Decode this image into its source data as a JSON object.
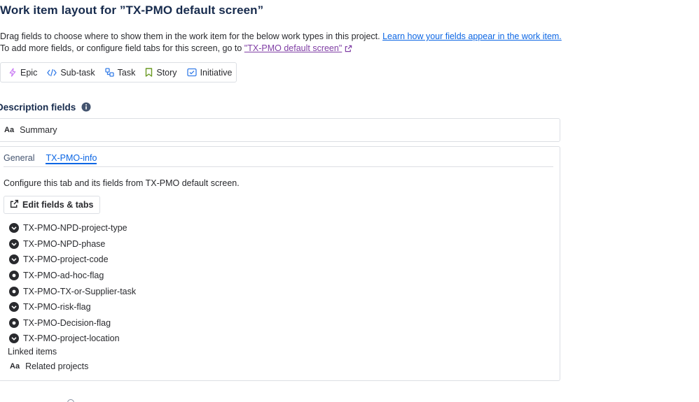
{
  "title": "Work item layout for ”TX-PMO default screen”",
  "intro": {
    "line1_text": "Drag fields to choose where to show them in the work item for the below work types in this project. ",
    "line1_link": "Learn how your fields appear in the work item.",
    "line2_text": "To add more fields, or configure field tabs for this screen, go to ",
    "line2_link": "\"TX-PMO default screen\""
  },
  "work_types": [
    {
      "label": "Epic",
      "icon": "lightning-icon",
      "color": "#c97cf4"
    },
    {
      "label": "Sub-task",
      "icon": "code-icon",
      "color": "#357de8"
    },
    {
      "label": "Task",
      "icon": "subtask-icon",
      "color": "#357de8"
    },
    {
      "label": "Story",
      "icon": "bookmark-icon",
      "color": "#6a9a23"
    },
    {
      "label": "Initiative",
      "icon": "checkbox-icon",
      "color": "#357de8"
    }
  ],
  "description_section": {
    "title": "Description fields",
    "summary_label": "Summary",
    "summary_icon_text": "Aa"
  },
  "tabs": [
    {
      "label": "General",
      "active": false
    },
    {
      "label": "TX-PMO-info",
      "active": true
    }
  ],
  "tab_content": {
    "config_text": "Configure this tab and its fields from TX-PMO default screen.",
    "edit_button": "Edit fields & tabs"
  },
  "fields": [
    {
      "label": "TX-PMO-NPD-project-type",
      "icon": "dropdown-icon"
    },
    {
      "label": "TX-PMO-NPD-phase",
      "icon": "dropdown-icon"
    },
    {
      "label": "TX-PMO-project-code",
      "icon": "dropdown-icon"
    },
    {
      "label": "TX-PMO-ad-hoc-flag",
      "icon": "radio-icon"
    },
    {
      "label": "TX-PMO-TX-or-Supplier-task",
      "icon": "radio-icon"
    },
    {
      "label": "TX-PMO-risk-flag",
      "icon": "dropdown-icon"
    },
    {
      "label": "TX-PMO-Decision-flag",
      "icon": "radio-icon"
    },
    {
      "label": "TX-PMO-project-location",
      "icon": "dropdown-icon"
    }
  ],
  "linked_items_label": "Linked items",
  "related_projects": {
    "label": "Related projects",
    "icon_text": "Aa"
  }
}
